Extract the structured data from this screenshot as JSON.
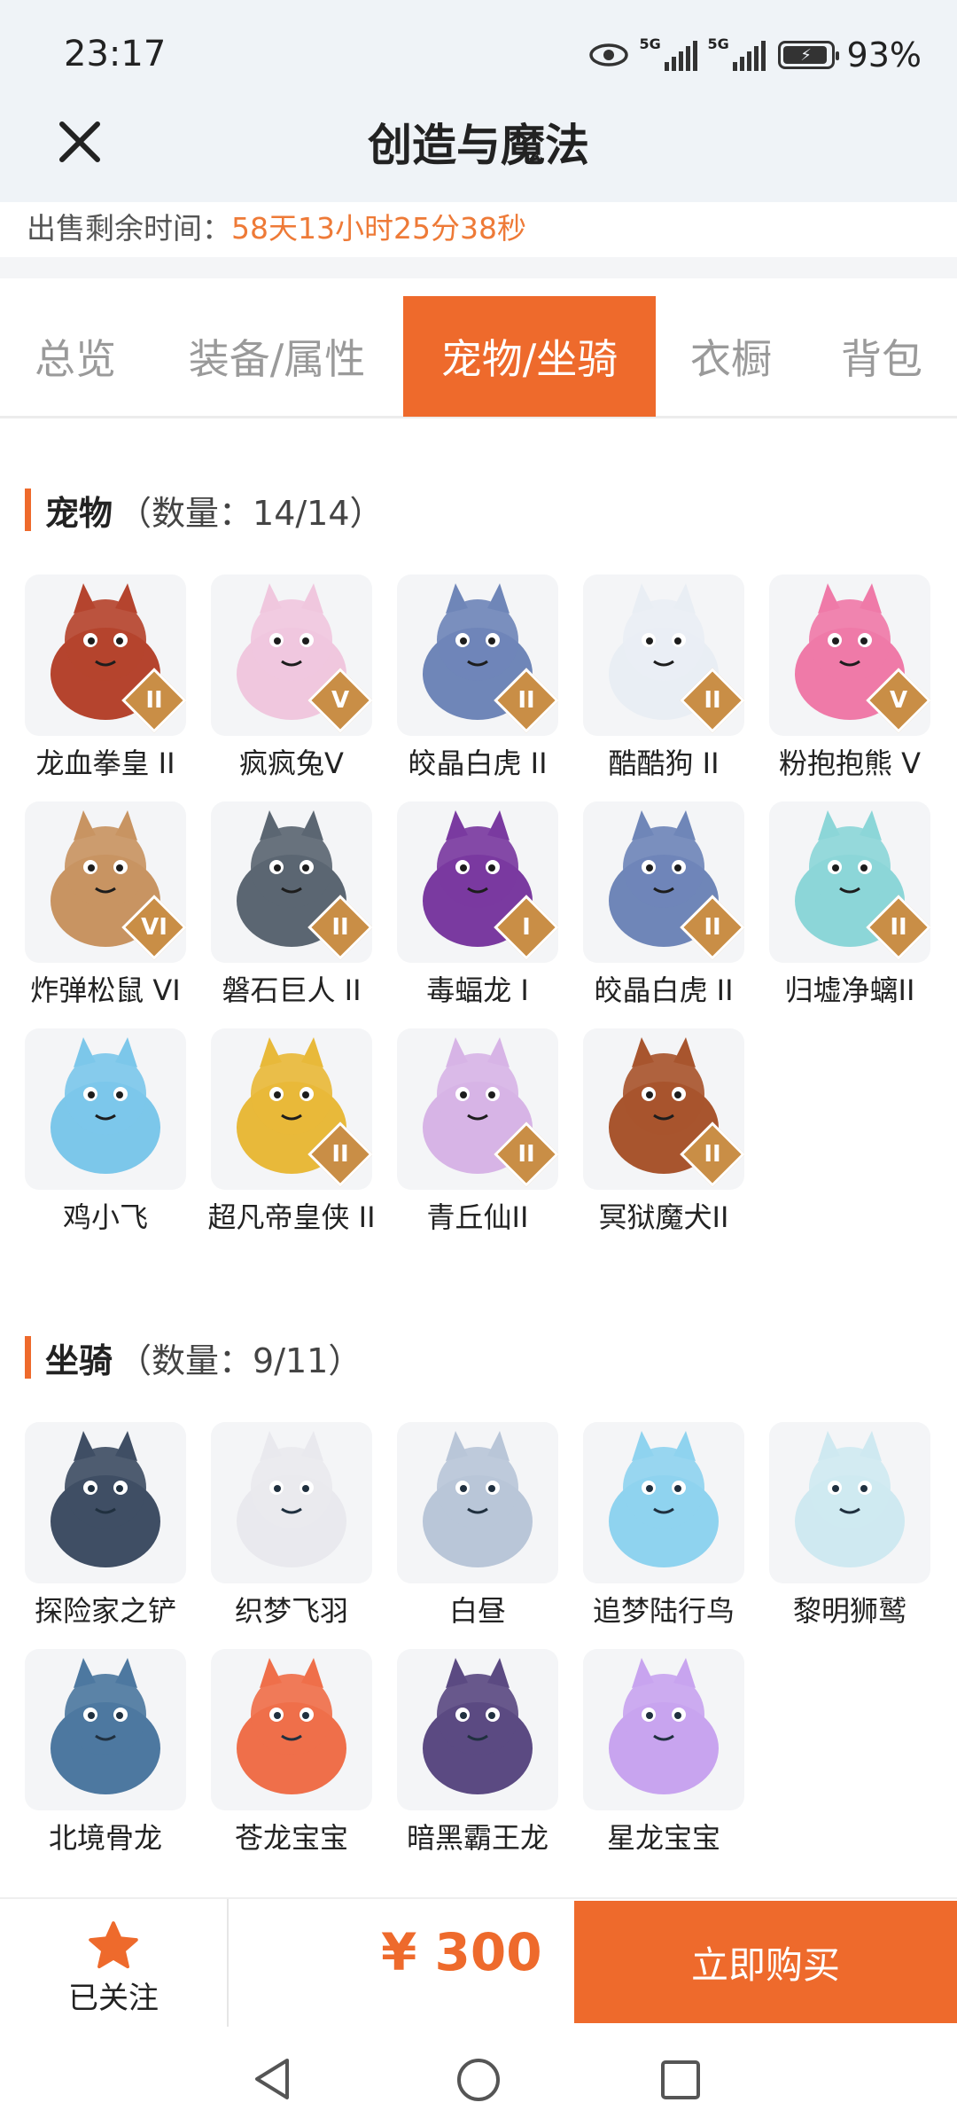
{
  "status": {
    "time": "23:17",
    "signal1": "5G",
    "signal2": "5G",
    "battery": "93%"
  },
  "header": {
    "title": "创造与魔法",
    "close_icon": "close-icon"
  },
  "sale": {
    "label": "出售剩余时间：",
    "value": "58天13小时25分38秒"
  },
  "tabs": [
    {
      "label": "总览",
      "active": false
    },
    {
      "label": "装备/属性",
      "active": false
    },
    {
      "label": "宠物/坐骑",
      "active": true
    },
    {
      "label": "衣橱",
      "active": false
    },
    {
      "label": "背包",
      "active": false
    }
  ],
  "pets": {
    "title": "宠物",
    "count": "（数量：14/14）",
    "items": [
      {
        "name": "龙血拳皇 II",
        "badge": "II",
        "color": "#b5442e"
      },
      {
        "name": "疯疯兔V",
        "badge": "V",
        "color": "#f0c7de"
      },
      {
        "name": "皎晶白虎 II",
        "badge": "II",
        "color": "#6f86b8"
      },
      {
        "name": "酷酷狗 II",
        "badge": "II",
        "color": "#e9eef4"
      },
      {
        "name": "粉抱抱熊 V",
        "badge": "V",
        "color": "#ef7aa8"
      },
      {
        "name": "炸弹松鼠 VI",
        "badge": "VI",
        "color": "#c89462"
      },
      {
        "name": "磐石巨人 II",
        "badge": "II",
        "color": "#5b6672"
      },
      {
        "name": "毒蝠龙 I",
        "badge": "I",
        "color": "#7a3aa0"
      },
      {
        "name": "皎晶白虎 II",
        "badge": "II",
        "color": "#6f86b8"
      },
      {
        "name": "归墟净螭II",
        "badge": "II",
        "color": "#8cd6d8"
      },
      {
        "name": "鸡小飞",
        "badge": "",
        "color": "#7cc7ea"
      },
      {
        "name": "超凡帝皇侠 II",
        "badge": "II",
        "color": "#e8b93a"
      },
      {
        "name": "青丘仙II",
        "badge": "II",
        "color": "#d7b4e6"
      },
      {
        "name": "冥狱魔犬II",
        "badge": "II",
        "color": "#a8552e"
      }
    ]
  },
  "mounts": {
    "title": "坐骑",
    "count": "（数量：9/11）",
    "items": [
      {
        "name": "探险家之铲",
        "color": "#3f4e64"
      },
      {
        "name": "织梦飞羽",
        "color": "#e9e9ee"
      },
      {
        "name": "白昼",
        "color": "#b9c6d8"
      },
      {
        "name": "追梦陆行鸟",
        "color": "#8fd3ef"
      },
      {
        "name": "黎明狮鹫",
        "color": "#cfe9f1"
      },
      {
        "name": "北境骨龙",
        "color": "#4d78a0"
      },
      {
        "name": "苍龙宝宝",
        "color": "#ef6f4a"
      },
      {
        "name": "暗黑霸王龙",
        "color": "#5b4a82"
      },
      {
        "name": "星龙宝宝",
        "color": "#c8a4ef"
      }
    ]
  },
  "bottom_bar": {
    "follow_label": "已关注",
    "price": "¥ 300",
    "buy_label": "立即购买",
    "accent": "#ee6a2c"
  }
}
